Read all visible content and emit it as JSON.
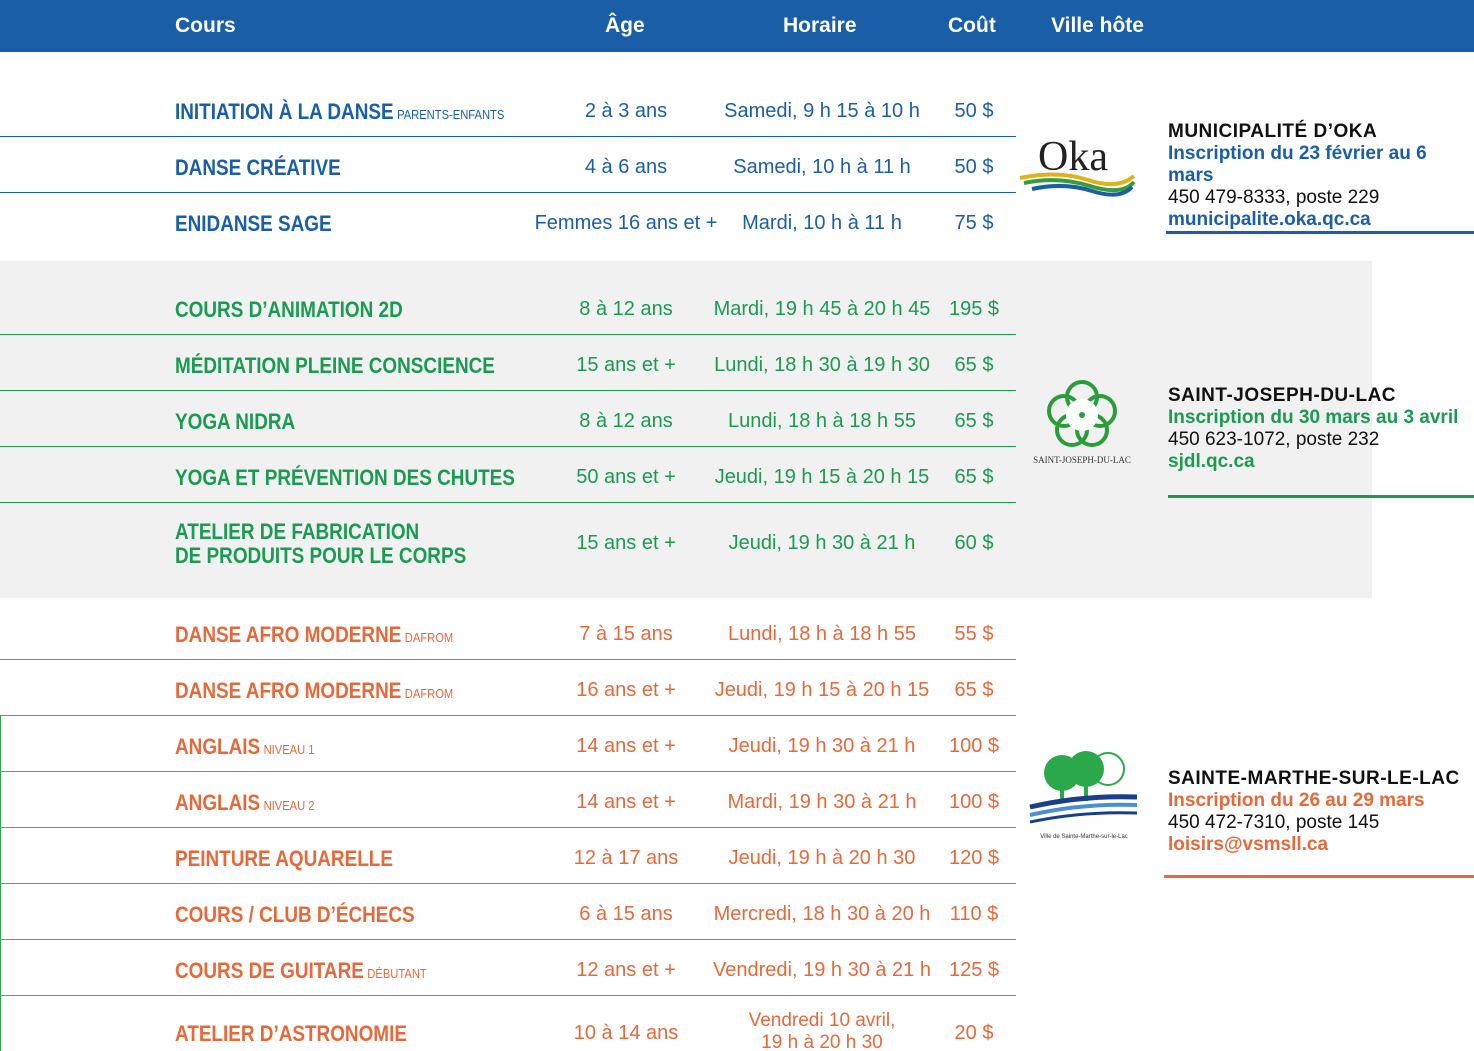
{
  "header": {
    "cours": "Cours",
    "age": "Âge",
    "horaire": "Horaire",
    "cout": "Coût",
    "ville": "Ville hôte"
  },
  "colors": {
    "blue": "#1a5ea8",
    "green": "#1b9a52",
    "orange": "#e8683a"
  },
  "groups": [
    {
      "color": "blue",
      "rows": [
        {
          "name": "INITIATION À LA DANSE",
          "tag": "PARENTS-ENFANTS",
          "age": "2 à 3 ans",
          "horaire": "Samedi, 9 h 15 à 10 h",
          "cout": "50 $"
        },
        {
          "name": "DANSE CRÉATIVE",
          "tag": "",
          "age": "4 à 6 ans",
          "horaire": "Samedi, 10 h à 11 h",
          "cout": "50 $"
        },
        {
          "name": "ENIDANSE SAGE",
          "tag": "",
          "age": "Femmes 16 ans et +",
          "horaire": "Mardi, 10 h à 11 h",
          "cout": "75 $"
        }
      ]
    },
    {
      "color": "green",
      "rows": [
        {
          "name": "COURS D’ANIMATION 2D",
          "tag": "",
          "age": "8 à 12 ans",
          "horaire": "Mardi, 19 h 45 à 20 h 45",
          "cout": "195 $"
        },
        {
          "name": "MÉDITATION PLEINE CONSCIENCE",
          "tag": "",
          "age": "15 ans et +",
          "horaire": "Lundi, 18 h 30 à 19 h 30",
          "cout": "65 $"
        },
        {
          "name": "YOGA NIDRA",
          "tag": "",
          "age": "8 à 12 ans",
          "horaire": "Lundi, 18 h à 18 h 55",
          "cout": "65 $"
        },
        {
          "name": "YOGA ET PRÉVENTION DES CHUTES",
          "tag": "",
          "age": "50 ans et +",
          "horaire": "Jeudi, 19 h 15 à 20 h 15",
          "cout": "65 $"
        },
        {
          "name": "ATELIER DE FABRICATION",
          "name2": "DE PRODUITS POUR LE CORPS",
          "tag": "",
          "age": "15 ans et +",
          "horaire": "Jeudi, 19 h 30 à 21 h",
          "cout": "60 $"
        }
      ]
    },
    {
      "color": "orange",
      "rows": [
        {
          "name": "DANSE AFRO MODERNE",
          "tag": "DAFROM",
          "age": "7 à 15 ans",
          "horaire": "Lundi, 18 h à 18 h 55",
          "cout": "55 $"
        },
        {
          "name": "DANSE AFRO MODERNE",
          "tag": "DAFROM",
          "age": "16 ans et +",
          "horaire": "Jeudi, 19 h 15 à 20 h 15",
          "cout": "65 $"
        },
        {
          "name": "ANGLAIS",
          "tag": "NIVEAU 1",
          "age": "14 ans et +",
          "horaire": "Jeudi, 19 h 30 à 21 h",
          "cout": "100 $"
        },
        {
          "name": "ANGLAIS",
          "tag": "NIVEAU 2",
          "age": "14 ans et +",
          "horaire": "Mardi, 19 h 30 à 21 h",
          "cout": "100 $"
        },
        {
          "name": "PEINTURE AQUARELLE",
          "tag": "",
          "age": "12 à 17 ans",
          "horaire": "Jeudi, 19 h à 20 h 30",
          "cout": "120 $"
        },
        {
          "name": "COURS / CLUB D’ÉCHECS",
          "tag": "",
          "age": "6 à 15 ans",
          "horaire": "Mercredi, 18 h 30 à 20 h",
          "cout": "110 $"
        },
        {
          "name": "COURS DE GUITARE",
          "tag": "DÉBUTANT",
          "age": "12 ans et +",
          "horaire": "Vendredi, 19 h 30 à 21 h",
          "cout": "125 $"
        },
        {
          "name": "ATELIER D’ASTRONOMIE",
          "tag": "",
          "age": "10 à 14 ans",
          "horaire": "Vendredi 10 avril,",
          "horaire2": "19 h à 20 h 30",
          "cout": "20 $"
        }
      ]
    }
  ],
  "hosts": [
    {
      "logo_text": "Oka",
      "name": "MUNICIPALITÉ D’OKA",
      "inscription": "Inscription du 23 février au 6 mars",
      "tel": "450 479-8333, poste 229",
      "site": "municipalite.oka.qc.ca",
      "color": "blue"
    },
    {
      "logo_text": "SAINT-JOSEPH-DU-LAC",
      "name": "SAINT-JOSEPH-DU-LAC",
      "inscription": "Inscription du 30 mars au 3 avril",
      "tel": "450 623-1072, poste 232",
      "site": "sjdl.qc.ca",
      "color": "green"
    },
    {
      "logo_text": "Ville de Sainte-Marthe-sur-le-Lac",
      "name": "SAINTE-MARTHE-SUR-LE-LAC",
      "inscription": "Inscription du 26 au 29 mars",
      "tel": "450 472-7310, poste 145",
      "site": "loisirs@vsmsll.ca",
      "color": "orange"
    }
  ]
}
